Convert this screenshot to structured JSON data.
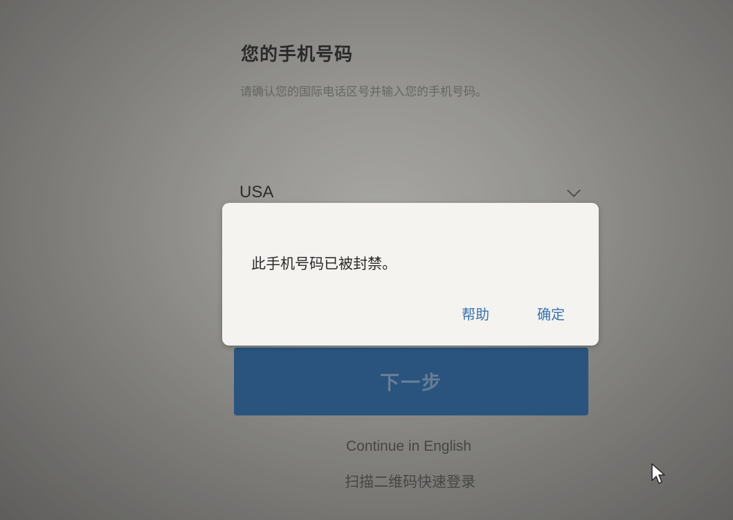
{
  "page": {
    "title": "您的手机号码",
    "subtitle": "请确认您的国际电话区号并输入您的手机号码。",
    "country_select": {
      "value": "USA"
    },
    "next_button_label": "下一步",
    "continue_english_label": "Continue in English",
    "qr_login_label": "扫描二维码快速登录"
  },
  "dialog": {
    "message": "此手机号码已被封禁。",
    "help_label": "帮助",
    "ok_label": "确定"
  },
  "colors": {
    "primary_button": "#2b5a8a",
    "dialog_link": "#3a72b0"
  },
  "icons": [
    "chevron-down-icon",
    "mouse-cursor-icon"
  ]
}
